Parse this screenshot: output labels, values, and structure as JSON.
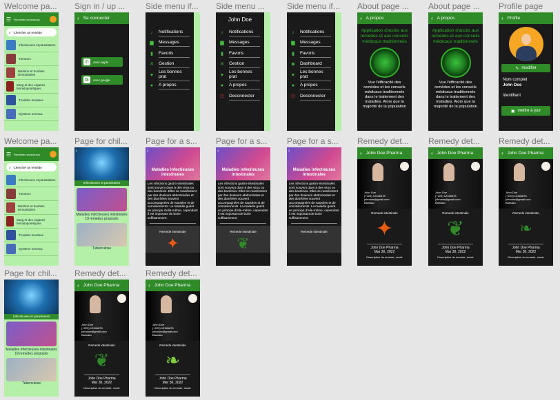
{
  "frames": {
    "welcome": {
      "label": "Welcome pa...",
      "app_title": "Remèdes ancestraux",
      "search": "Chercher un remède",
      "items": [
        "Infectieuses et parasitaires",
        "Tumeurs",
        "Nutrition et troubles immunitaires",
        "Sang et des organes hématopoïétiques",
        "Troubles mentaux",
        "Systeme nerveux"
      ]
    },
    "signin": {
      "label": "Sign in / up ...",
      "bar_title": "Se connecter",
      "apple": "Avec apple",
      "google": "Avec google"
    },
    "side1": {
      "label": "Side menu if...",
      "items": [
        "Notifications",
        "Messages",
        "Favoris",
        "Gestion",
        "Les bonnes prat",
        "A propos"
      ]
    },
    "side2": {
      "label": "Side menu ...",
      "user": "John Doe",
      "items": [
        "Notifications",
        "Messages",
        "Favoris",
        "Gestion",
        "Les bonnes prat",
        "A propos",
        "Deconnecter"
      ]
    },
    "side3": {
      "label": "Side menu if...",
      "items": [
        "Notifications",
        "Messages",
        "Favoris",
        "Dashboard",
        "Les bonnes prat",
        "A propos",
        "Deconnecter"
      ]
    },
    "about1": {
      "label": "About page ...",
      "bar_title": "A propos",
      "headline": "Application d'accès aux remèdes et aux conseils médicaux traditionnels",
      "body": "Vue l'efficacité des remèdes et les conseils médicaux traditionnels dans le traitement des maladies. Alors que la majorité de la population"
    },
    "about2": {
      "label": "About page ...",
      "bar_title": "A propos",
      "headline": "Application d'accès aux remèdes et aux conseils médicaux traditionnels",
      "body": "Vue l'efficacité des remèdes et les conseils médicaux traditionnels dans le traitement des maladies. Alors que la majorité de la population"
    },
    "profile": {
      "label": "Profile page",
      "bar_title": "Profile",
      "edit": "modifier",
      "full_name_label": "Nom complet",
      "full_name": "John Doe",
      "id_label": "Identifiant",
      "update": "mettre à jour"
    },
    "welcome2": {
      "label": "Welcome pa...",
      "app_title": "Remèdes ancestraux",
      "search": "Chercher un remède",
      "items": [
        "Infectieuses et parasitaires",
        "Tumeurs",
        "Nutrition et troubles immunitaires",
        "Sang et des organes hématopoïétiques",
        "Troubles mentaux",
        "Systeme nerveux"
      ]
    },
    "child1": {
      "label": "Page for chil...",
      "card1": "Infectieuses et parasitaires",
      "card2_title": "Maladies infectieuses intestinales",
      "card2_sub": "19 remedes proposés",
      "card3": "Tuberculose"
    },
    "sick1": {
      "label": "Page for a s...",
      "title": "Maladies infectieuses intestinales",
      "body": "Les infections gastro-intestinales sont souvent dues à des virus ou des bactéries. Elles se manifestent par des douleurs abdominales et des diarrhées souvent accompagnées de nausées et de vomissements. La maladie guérit en principe d'elle-même, cependant il est important de boire suffisamment.",
      "remedy": "Remede intestinale"
    },
    "sick2": {
      "label": "Page for a s...",
      "title": "Maladies infectieuses intestinales",
      "body": "Les infections gastro-intestinales sont souvent dues à des virus ou des bactéries. Elles se manifestent par des douleurs abdominales et des diarrhées souvent accompagnées de nausées et de vomissements. La maladie guérit en principe d'elle-même, cependant il est important de boire suffisamment.",
      "remedy": "Remede intestinale"
    },
    "sick3": {
      "label": "Page for a s...",
      "title": "Maladies infectieuses intestinales",
      "body": "Les infections gastro-intestinales sont souvent dues à des virus ou des bactéries. Elles se manifestent par des douleurs abdominales et des diarrhées souvent accompagnées de nausées et de vomissements. La maladie guérit en principe d'elle-même, cependant il est important de boire suffisamment.",
      "remedy": "Remede intestinale"
    },
    "remedy1": {
      "label": "Remedy det...",
      "bar_title": "John Doe Pharma",
      "name": "John Doe",
      "phone": "(+223) 12345678",
      "email": "johndoe@gmail.com",
      "city": "Bamako",
      "remedy": "Remede intestinale",
      "pharma": "John Doe Pharma",
      "date": "Mar 30, 2022",
      "desc": "Description du remede, mode"
    },
    "remedy2": {
      "label": "Remedy det...",
      "bar_title": "John Doe Pharma",
      "name": "John Doe",
      "phone": "(+223) 12345678",
      "email": "johndoe@gmail.com",
      "city": "Bamako",
      "remedy": "Remede intestinale",
      "pharma": "John Doe Pharma",
      "date": "Mar 30, 2022",
      "desc": "Description du remede, mode"
    },
    "remedy3": {
      "label": "Remedy det...",
      "bar_title": "John Doe Pharma",
      "name": "John Doe",
      "phone": "(+223) 12345678",
      "email": "johndoe@gmail.com",
      "city": "Bamako",
      "remedy": "Remede intestinale",
      "pharma": "John Doe Pharma",
      "date": "Mar 30, 2022",
      "desc": "Description du remede, mode"
    },
    "child2": {
      "label": "Page for chil...",
      "card1": "Infectieuses et parasitaires",
      "card2_title": "Maladies infectieuses intestinales",
      "card2_sub": "19 remedes proposés",
      "card3": "Tuberculose"
    },
    "remedy4": {
      "label": "Remedy det...",
      "bar_title": "John Doe Pharma",
      "name": "John Doe",
      "phone": "(+223) 12345678",
      "email": "johndoe@gmail.com",
      "city": "Bamako",
      "remedy": "Remede intestinale",
      "pharma": "John Doe Pharma",
      "date": "Mar 30, 2022",
      "desc": "Description du remede, mode"
    },
    "remedy5": {
      "label": "Remedy det...",
      "bar_title": "John Doe Pharma",
      "name": "John Doe",
      "phone": "(+223) 12345678",
      "email": "johndoe@gmail.com",
      "city": "Bamako",
      "remedy": "Remede intestinale",
      "pharma": "John Doe Pharma",
      "date": "Mar 30, 2022",
      "desc": "Description du remede, mode"
    }
  },
  "colors": {
    "green": "#2e8b27",
    "light_green": "#b5f0a8",
    "dark": "#1a1a1a",
    "bg": "#e6e6e6"
  }
}
